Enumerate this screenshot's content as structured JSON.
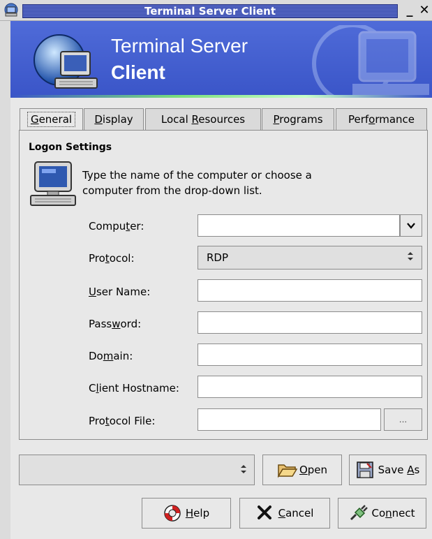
{
  "window": {
    "title": "Terminal Server Client",
    "minimize_glyph": "_",
    "close_glyph": "✕"
  },
  "banner": {
    "line1": "Terminal Server",
    "line2": "Client"
  },
  "tabs": [
    {
      "label": "General",
      "underline_index": 0,
      "active": true
    },
    {
      "label": "Display",
      "underline_index": 0,
      "active": false
    },
    {
      "label": "Local Resources",
      "underline_index": 6,
      "active": false
    },
    {
      "label": "Programs",
      "underline_index": 0,
      "active": false
    },
    {
      "label": "Performance",
      "underline_index": 4,
      "active": false
    }
  ],
  "logon": {
    "section_title": "Logon Settings",
    "description": "Type the name of the computer or choose a computer from the drop-down list.",
    "fields": {
      "computer": {
        "label": "Computer:",
        "value": ""
      },
      "protocol": {
        "label": "Protocol:",
        "value": "RDP"
      },
      "user_name": {
        "label": "User Name:",
        "value": ""
      },
      "password": {
        "label": "Password:",
        "value": ""
      },
      "domain": {
        "label": "Domain:",
        "value": ""
      },
      "client_hostname": {
        "label": "Client Hostname:",
        "value": ""
      },
      "protocol_file": {
        "label": "Protocol File:",
        "value": ""
      }
    },
    "browse_label": "..."
  },
  "bottom": {
    "profile_value": "",
    "open_label": "Open",
    "save_as_label": "Save As",
    "help_label": "Help",
    "cancel_label": "Cancel",
    "connect_label": "Connect"
  },
  "icons": {
    "app": "computer-globe-icon",
    "banner": "computer-globe-icon",
    "logon": "computer-icon",
    "open": "folder-open-icon",
    "save_as": "floppy-disk-icon",
    "help": "lifebuoy-icon",
    "cancel": "x-mark-icon",
    "connect": "plug-icon"
  },
  "colors": {
    "banner_blue": "#3a55c8",
    "title_blue": "#4a5cbe",
    "window_bg": "#e8e8e8"
  }
}
